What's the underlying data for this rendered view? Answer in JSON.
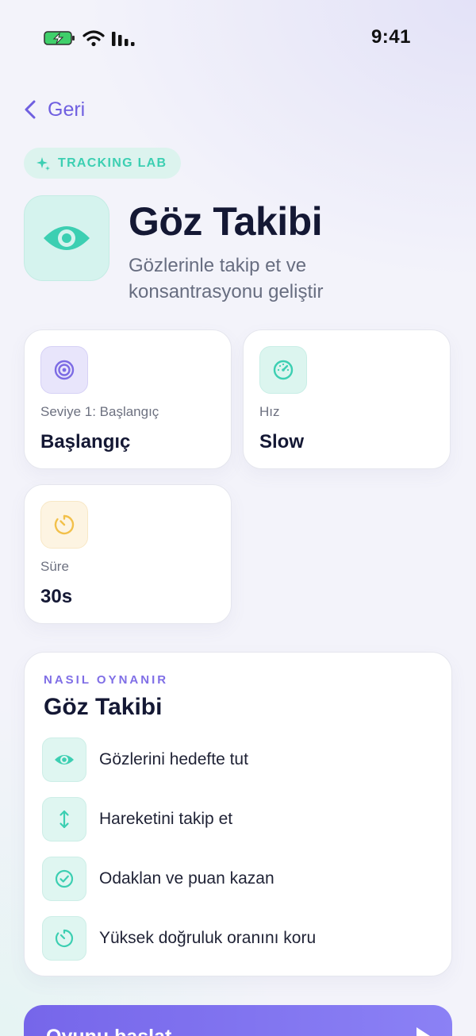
{
  "status_bar": {
    "time": "9:41"
  },
  "nav": {
    "back_label": "Geri"
  },
  "badge": {
    "label": "TRACKING LAB"
  },
  "hero": {
    "title": "Göz Takibi",
    "subtitle": "Gözlerinle takip et ve konsantrasyonu geliştir",
    "icon": "eye-icon"
  },
  "stats": [
    {
      "label": "Seviye 1: Başlangıç",
      "value": "Başlangıç",
      "icon": "target-icon",
      "color": "#7c6be4"
    },
    {
      "label": "Hız",
      "value": "Slow",
      "icon": "speedometer-icon",
      "color": "#3ccfb2"
    },
    {
      "label": "Süre",
      "value": "30s",
      "icon": "timer-icon",
      "color": "#f2c04a"
    }
  ],
  "how_to_play": {
    "overline": "NASIL OYNANIR",
    "title": "Göz Takibi",
    "steps": [
      {
        "text": "Gözlerini hedefte tut",
        "icon": "eye-icon"
      },
      {
        "text": "Hareketini takip et",
        "icon": "vertical-arrows-icon"
      },
      {
        "text": "Odaklan ve puan kazan",
        "icon": "check-circle-icon"
      },
      {
        "text": "Yüksek doğruluk oranını koru",
        "icon": "timer-icon"
      }
    ]
  },
  "start_button": {
    "label": "Oyunu başlat"
  },
  "colors": {
    "accent_purple": "#7666ea",
    "accent_teal": "#3ccfb2",
    "accent_yellow": "#f2c04a",
    "title": "#141834"
  }
}
